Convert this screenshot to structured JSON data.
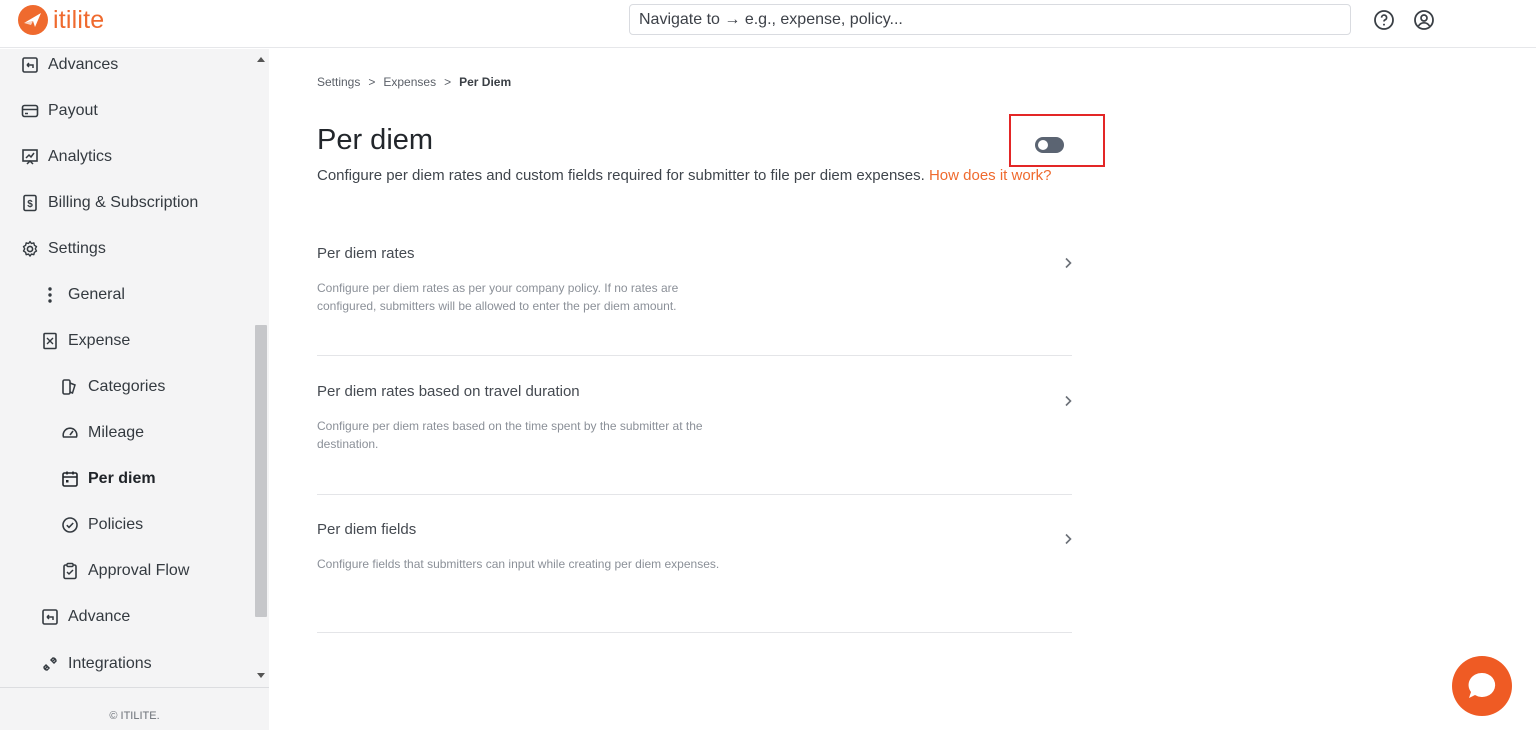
{
  "app": {
    "logo_text": "itilite",
    "brand_color": "#ef6a2e"
  },
  "topbar": {
    "search_placeholder": "Navigate to → e.g., expense, policy...",
    "help_icon": "help-circle-icon",
    "profile_icon": "user-circle-icon"
  },
  "sidebar": {
    "items": [
      {
        "label": "Advances",
        "icon": "advance-receipt-icon"
      },
      {
        "label": "Payout",
        "icon": "card-icon"
      },
      {
        "label": "Analytics",
        "icon": "presentation-chart-icon"
      },
      {
        "label": "Billing & Subscription",
        "icon": "billing-receipt-icon"
      },
      {
        "label": "Settings",
        "icon": "gear-icon"
      },
      {
        "label": "General",
        "icon": "vertical-dots-icon"
      },
      {
        "label": "Expense",
        "icon": "expense-receipt-icon"
      },
      {
        "label": "Categories",
        "icon": "categories-icon"
      },
      {
        "label": "Mileage",
        "icon": "speedometer-icon"
      },
      {
        "label": "Per diem",
        "icon": "calendar-icon"
      },
      {
        "label": "Policies",
        "icon": "check-circle-icon"
      },
      {
        "label": "Approval Flow",
        "icon": "clipboard-check-icon"
      },
      {
        "label": "Advance",
        "icon": "advance-receipt-icon"
      },
      {
        "label": "Integrations",
        "icon": "integrations-icon"
      }
    ],
    "active": "Per diem",
    "footer": "© ITILITE."
  },
  "breadcrumb": {
    "items": [
      "Settings",
      "Expenses",
      "Per Diem"
    ],
    "separator": ">"
  },
  "page": {
    "title": "Per diem",
    "description": "Configure per diem rates and custom fields required for submitter to file per diem expenses.",
    "help_link": "How does it work?",
    "toggle_on": false
  },
  "rows": [
    {
      "title": "Per diem rates",
      "description": "Configure per diem rates as per your company policy. If no rates are configured, submitters will be allowed to enter the per diem amount."
    },
    {
      "title": "Per diem rates based on travel duration",
      "description": "Configure per diem rates based on the time spent by the submitter at the destination."
    },
    {
      "title": "Per diem fields",
      "description": "Configure fields that submitters can input while creating per diem expenses."
    }
  ],
  "chat": {
    "icon": "chat-bubble-icon"
  }
}
